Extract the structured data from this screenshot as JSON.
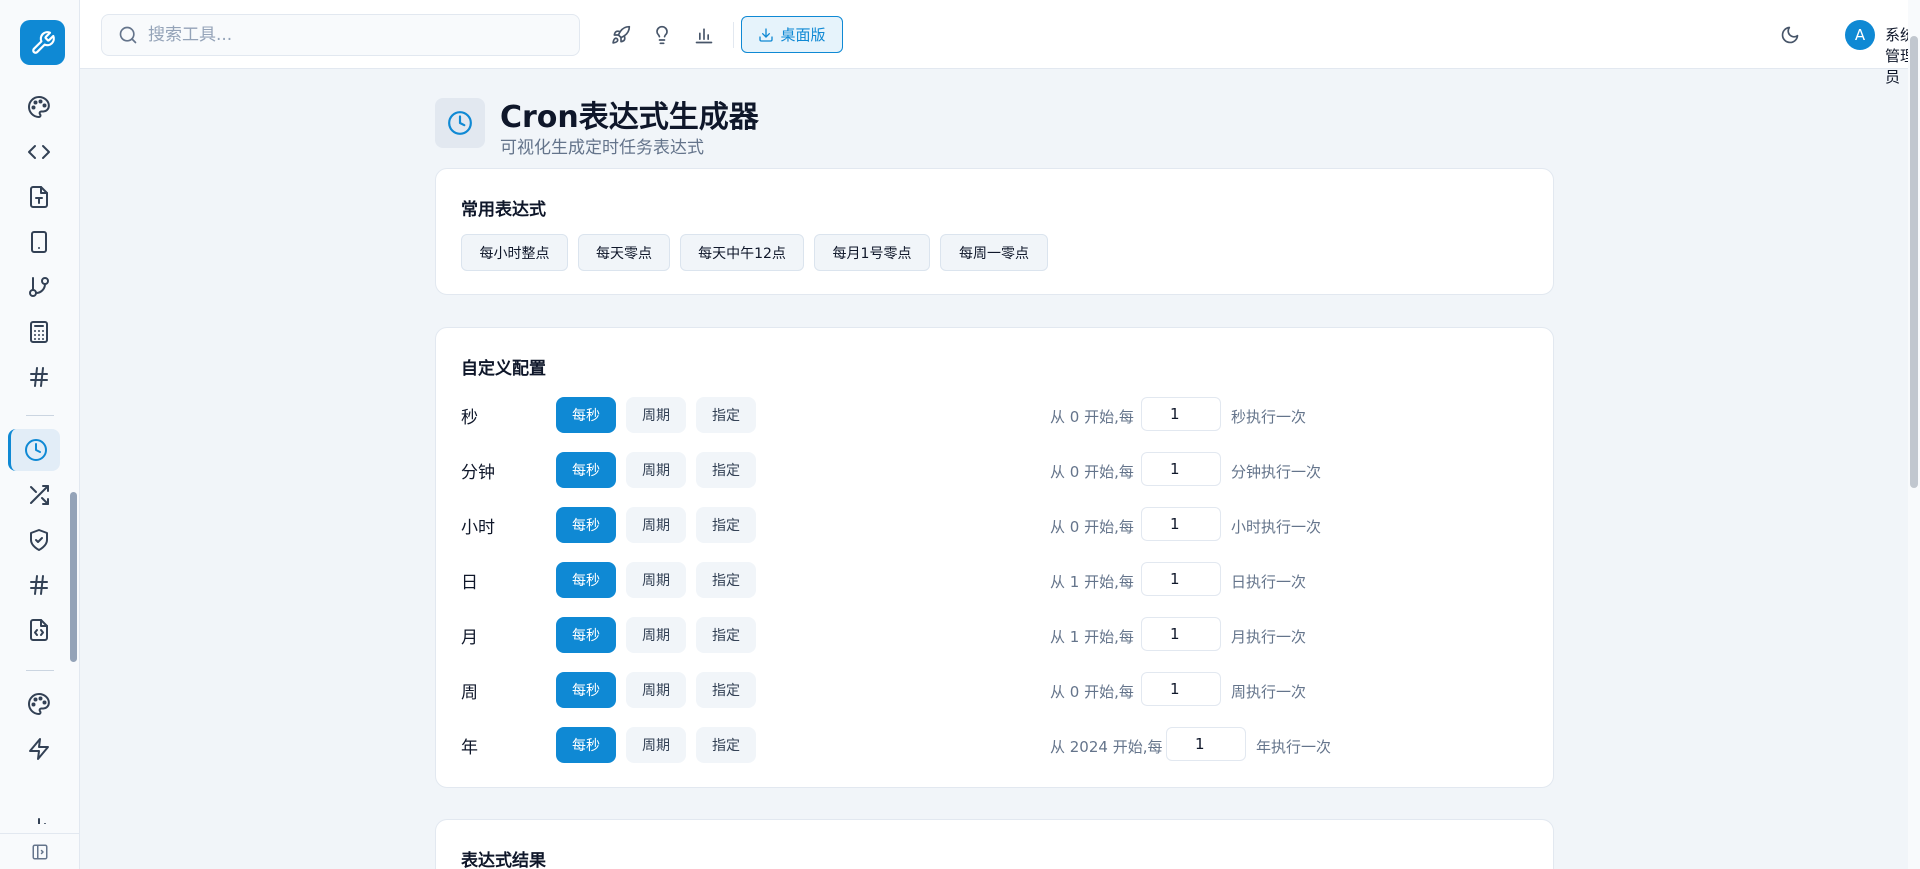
{
  "sidebar": {
    "logo_icon": "wrench-icon",
    "items": [
      {
        "icon": "palette-icon"
      },
      {
        "icon": "code-icon"
      },
      {
        "icon": "file-text-icon"
      },
      {
        "icon": "tablet-icon"
      },
      {
        "icon": "git-branch-icon"
      },
      {
        "icon": "calculator-icon"
      },
      {
        "icon": "hash-icon"
      },
      {
        "icon": "clock-icon",
        "active": true
      },
      {
        "icon": "shuffle-icon"
      },
      {
        "icon": "shield-check-icon"
      },
      {
        "icon": "hash-icon"
      },
      {
        "icon": "file-code-icon"
      },
      {
        "icon": "palette-icon"
      },
      {
        "icon": "zap-icon"
      },
      {
        "icon": "bar-chart-icon"
      }
    ],
    "collapse_icon": "panel-left-icon"
  },
  "header": {
    "search_placeholder": "搜索工具...",
    "desktop_button": "桌面版",
    "user_initial": "A",
    "user_name": "系统管理员"
  },
  "page": {
    "title": "Cron表达式生成器",
    "subtitle": "可视化生成定时任务表达式"
  },
  "presets": {
    "title": "常用表达式",
    "items": [
      "每小时整点",
      "每天零点",
      "每天中午12点",
      "每月1号零点",
      "每周一零点"
    ]
  },
  "custom": {
    "title": "自定义配置",
    "modes": [
      "每秒",
      "周期",
      "指定"
    ],
    "rows": [
      {
        "label": "秒",
        "prefix": "从 0 开始,每",
        "value": "1",
        "suffix": "秒执行一次"
      },
      {
        "label": "分钟",
        "prefix": "从 0 开始,每",
        "value": "1",
        "suffix": "分钟执行一次"
      },
      {
        "label": "小时",
        "prefix": "从 0 开始,每",
        "value": "1",
        "suffix": "小时执行一次"
      },
      {
        "label": "日",
        "prefix": "从 1 开始,每",
        "value": "1",
        "suffix": "日执行一次"
      },
      {
        "label": "月",
        "prefix": "从 1 开始,每",
        "value": "1",
        "suffix": "月执行一次"
      },
      {
        "label": "周",
        "prefix": "从 0 开始,每",
        "value": "1",
        "suffix": "周执行一次"
      },
      {
        "label": "年",
        "prefix": "从 2024 开始,每",
        "value": "1",
        "suffix": "年执行一次"
      }
    ]
  },
  "result": {
    "title": "表达式结果"
  },
  "colors": {
    "accent": "#0f89d4",
    "background": "#f1f5f9"
  }
}
